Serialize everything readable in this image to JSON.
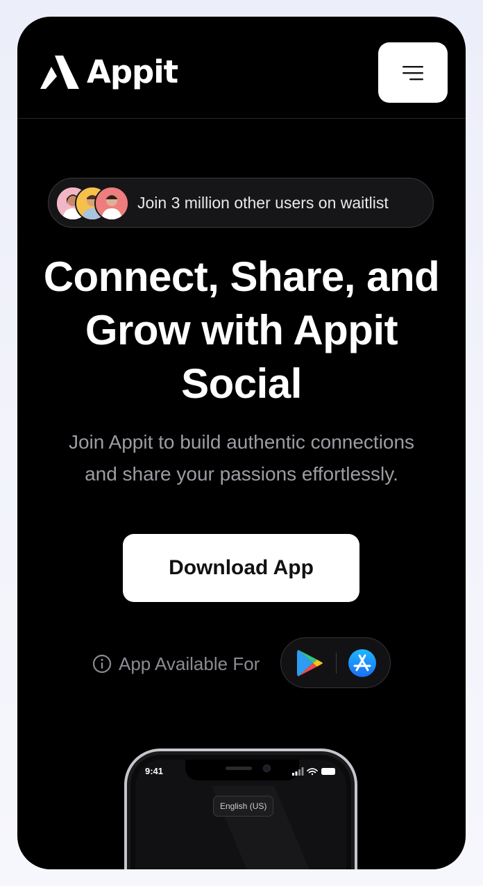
{
  "brand": {
    "name": "Appit"
  },
  "header": {
    "menu_icon": "hamburger-menu-icon"
  },
  "waitlist": {
    "text": "Join 3 million other users on waitlist"
  },
  "hero": {
    "headline_line1": "Connect, Share, and",
    "headline_line2": "Grow with Appit",
    "headline_line3": "Social",
    "subtitle_line1": "Join Appit to build authentic connections",
    "subtitle_line2": "and share your passions effortlessly."
  },
  "cta": {
    "download_label": "Download App"
  },
  "availability": {
    "label": "App Available For",
    "stores": [
      "google-play-icon",
      "app-store-icon"
    ]
  },
  "phone_preview": {
    "time": "9:41",
    "language": "English (US)"
  },
  "colors": {
    "background": "#000000",
    "button": "#ffffff",
    "subtitle": "#9c9ca3"
  }
}
